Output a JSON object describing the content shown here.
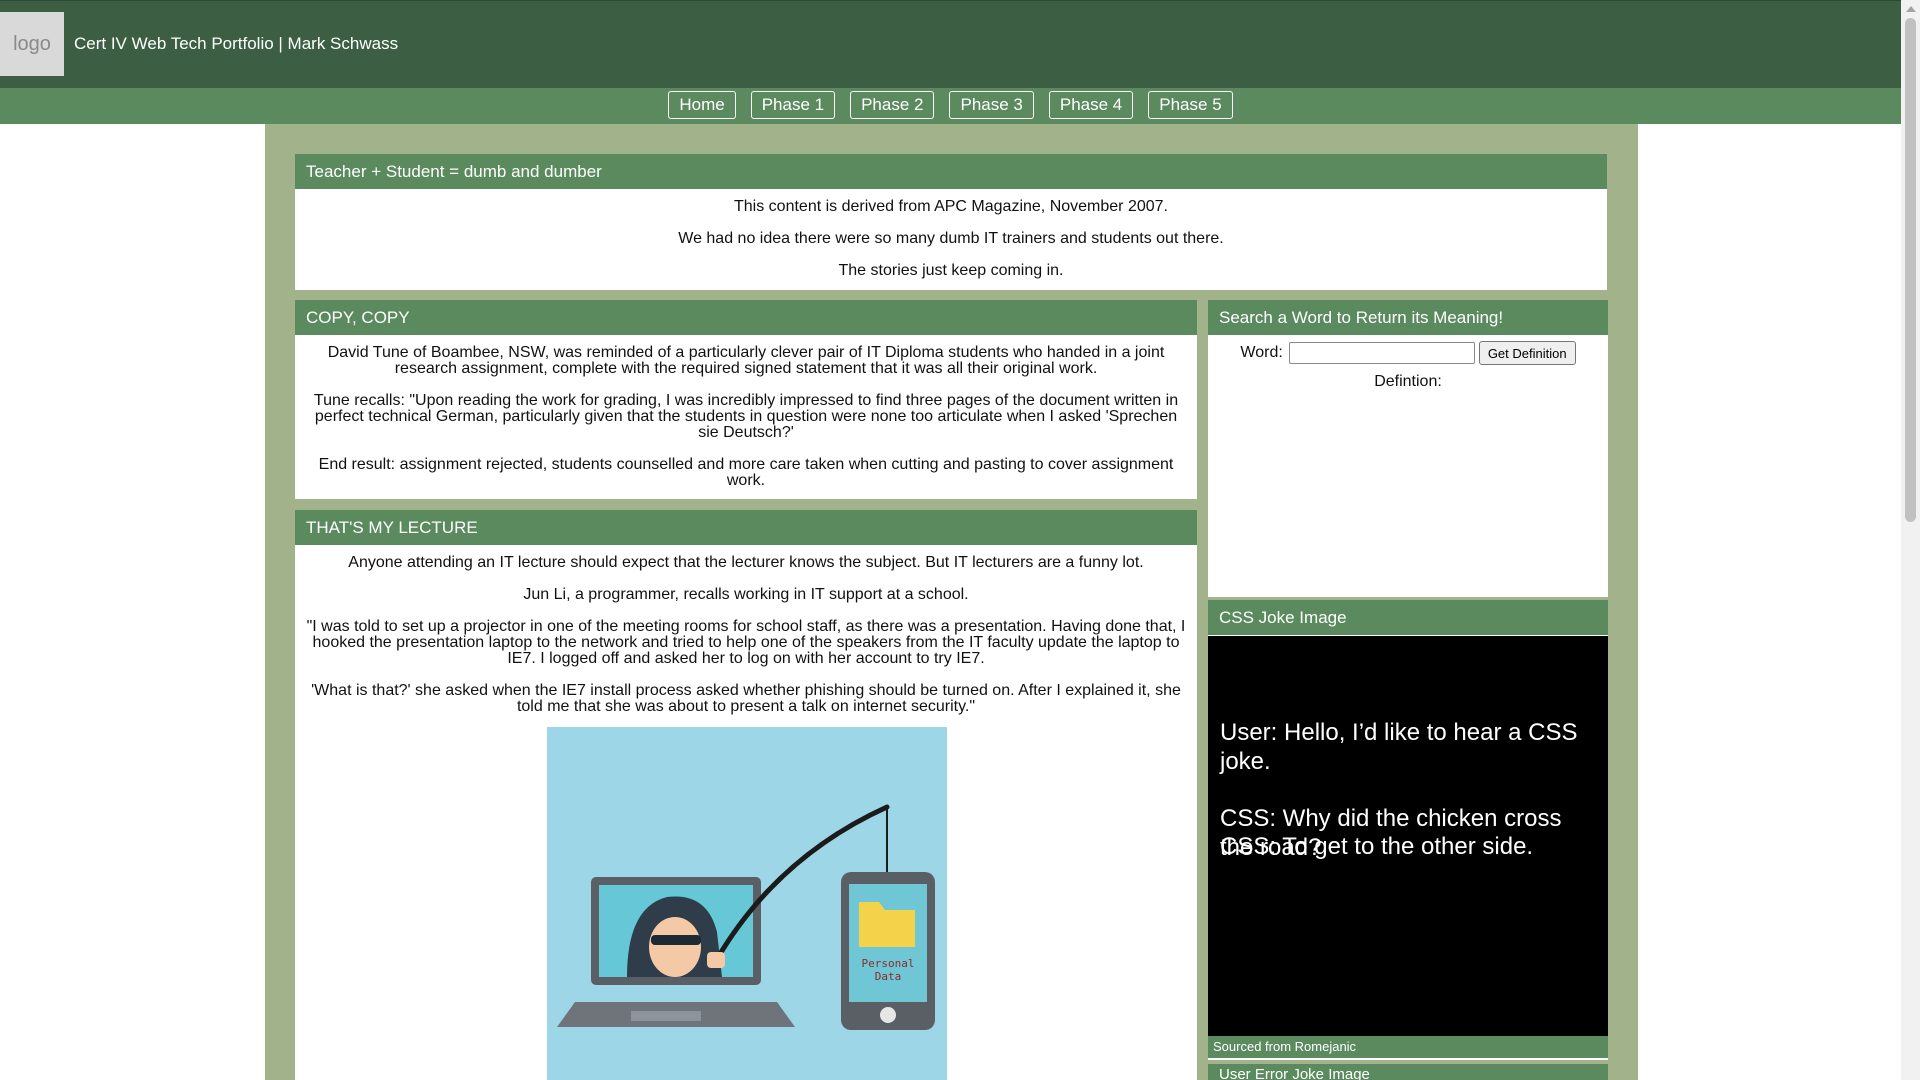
{
  "header": {
    "logo_text": "logo",
    "title": "Cert IV Web Tech Portfolio | Mark Schwass"
  },
  "nav": {
    "items": [
      "Home",
      "Phase 1",
      "Phase 2",
      "Phase 3",
      "Phase 4",
      "Phase 5"
    ]
  },
  "intro": {
    "heading": "Teacher + Student = dumb and dumber",
    "lines": [
      "This content is derived from APC Magazine, November 2007.",
      "We had no idea there were so many dumb IT trainers and students out there.",
      "The stories just keep coming in."
    ]
  },
  "copy_copy": {
    "heading": "COPY, COPY",
    "paragraphs": [
      "David Tune of Boambee, NSW, was reminded of a particularly clever pair of IT Diploma students who handed in a joint research assignment, complete with the required signed statement that it was all their original work.",
      "Tune recalls: \"Upon reading the work for grading, I was incredibly impressed to find three pages of the document written in perfect technical German, particularly given that the students in question were none too articulate when I asked 'Sprechen sie Deutsch?'",
      "End result: assignment rejected, students counselled and more care taken when cutting and pasting to cover assignment work."
    ]
  },
  "lecture": {
    "heading": "THAT'S MY LECTURE",
    "paragraphs": [
      "Anyone attending an IT lecture should expect that the lecturer knows the subject. But IT lecturers are a funny lot.",
      "Jun Li, a programmer, recalls working in IT support at a school.",
      "\"I was told to set up a projector in one of the meeting rooms for school staff, as there was a presentation. Having done that, I hooked the presentation laptop to the network and tried to help one of the speakers from the IT faculty update the laptop to IE7. I logged off and asked her to log on with her account to try IE7.",
      "'What is that?' she asked when the IE7 install process asked whether phishing should be turned on. After I explained it, she told me that she was about to present a talk on internet security.\""
    ],
    "image_label": "Personal Data"
  },
  "search": {
    "heading": "Search a Word to Return its Meaning!",
    "word_label": "Word:",
    "word_value": "",
    "button_label": "Get Definition",
    "definition_label": "Defintion:"
  },
  "css_joke": {
    "heading": "CSS Joke Image",
    "line1": "User: Hello, I’d like to hear a CSS joke.",
    "line2a": "CSS: Why did the chicken cross the road?",
    "line2b": "CSS: To get to the other side.",
    "source": "Sourced from Romejanic"
  },
  "user_error": {
    "heading": "User Error Joke Image"
  },
  "colors": {
    "header_bg": "#3c5e43",
    "nav_bg": "#5a8a5e",
    "wrapper_bg": "#a2b28a"
  }
}
